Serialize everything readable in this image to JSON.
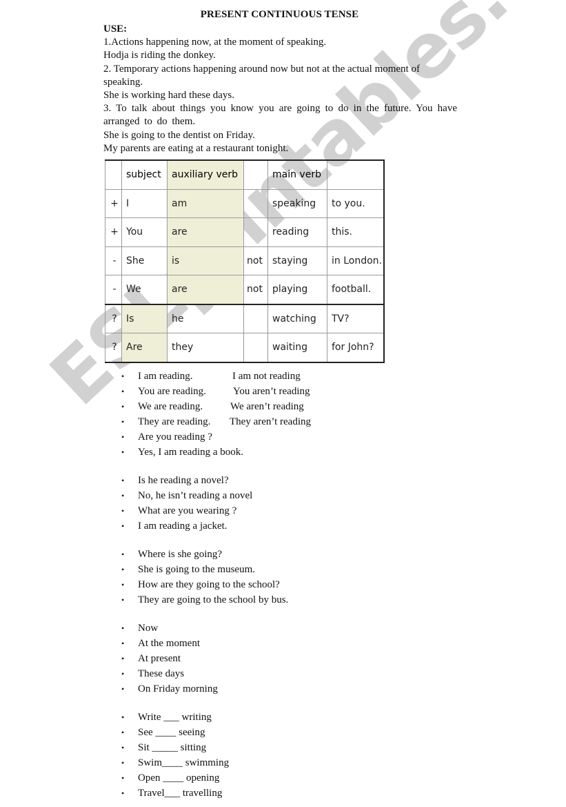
{
  "document": {
    "title": "PRESENT CONTINUOUS TENSE",
    "use_label": "USE:",
    "intro": [
      "1.Actions happening now, at the moment of speaking.",
      "Hodja is riding the donkey.",
      "2. Temporary actions happening around now but not at the actual moment of speaking.",
      "She is working hard these days.",
      "3. To talk about things you know you are going to do in the future. You have arranged to do them.",
      "She is going to the dentist on Friday.",
      "My parents are eating at a restaurant tonight."
    ]
  },
  "table": {
    "header": [
      "",
      "subject",
      "auxiliary verb",
      "",
      "main verb",
      ""
    ],
    "rows": [
      [
        "+",
        "I",
        "am",
        "",
        "speaking",
        "to you."
      ],
      [
        "+",
        "You",
        "are",
        "",
        "reading",
        "this."
      ],
      [
        "-",
        "She",
        "is",
        "not",
        "staying",
        "in London."
      ],
      [
        "-",
        "We",
        "are",
        "not",
        "playing",
        "football."
      ],
      [
        "?",
        "Is",
        "he",
        "",
        "watching",
        "TV?"
      ],
      [
        "?",
        "Are",
        "they",
        "",
        "waiting",
        "for John?"
      ]
    ],
    "highlight_color": "#efefd8"
  },
  "lists": {
    "bullet": "•",
    "affirmative_negative": [
      {
        "a": "I am reading.",
        "b": "I am not reading"
      },
      {
        "a": "You are reading.",
        "b": "You aren’t reading"
      },
      {
        "a": "We are reading.",
        "b": "We aren’t reading"
      },
      {
        "a": "They are reading.",
        "b": "They aren’t reading"
      },
      {
        "a": "Are you reading ?",
        "b": ""
      },
      {
        "a": "Yes, I am reading a book.",
        "b": ""
      }
    ],
    "questions_1": [
      "Is he reading a novel?",
      "No, he isn’t reading a novel",
      "What are you wearing ?",
      "I am reading a jacket."
    ],
    "questions_2": [
      "Where is she going?",
      "She is going to the museum.",
      "How are they going to the school?",
      "They are going to the school by bus."
    ],
    "time_expressions": [
      "Now",
      "At the moment",
      "At present",
      "These days",
      "On Friday morning"
    ],
    "spelling": [
      "Write ___ writing",
      "See ____ seeing",
      "Sit _____ sitting",
      "Swim____ swimming",
      "Open ____ opening",
      "Travel___ travelling"
    ]
  },
  "watermark": {
    "text": "ESLprintables.com",
    "color": "#c9c9c9"
  }
}
